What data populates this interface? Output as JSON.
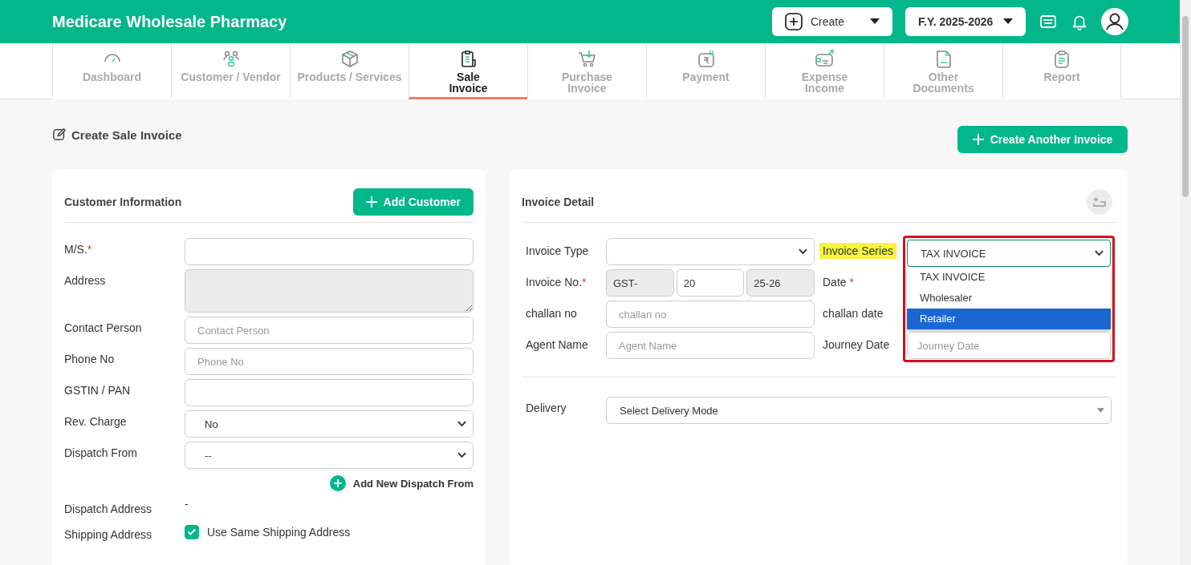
{
  "app": {
    "title": "Medicare Wholesale Pharmacy"
  },
  "header": {
    "create": "Create",
    "fiscal_year": "F.Y. 2025-2026"
  },
  "nav": [
    {
      "label": "Dashboard",
      "selected": false
    },
    {
      "label": "Customer / Vendor",
      "selected": false
    },
    {
      "label": "Products / Services",
      "selected": false
    },
    {
      "label": "Sale\nInvoice",
      "selected": true
    },
    {
      "label": "Purchase\nInvoice",
      "selected": false
    },
    {
      "label": "Payment",
      "selected": false
    },
    {
      "label": "Expense\nIncome",
      "selected": false
    },
    {
      "label": "Other\nDocuments",
      "selected": false
    },
    {
      "label": "Report",
      "selected": false
    }
  ],
  "page_heading": "Create Sale Invoice",
  "create_another_button": "Create Another Invoice",
  "customer_card": {
    "title": "Customer Information",
    "add_button": "Add Customer",
    "fields": [
      {
        "kind": "input",
        "label": "M/S.",
        "required_mark": "*"
      },
      {
        "kind": "textarea",
        "label": "Address",
        "disabled": true
      },
      {
        "kind": "input",
        "label": "Contact Person",
        "placeholder": "Contact Person"
      },
      {
        "kind": "input",
        "label": "Phone No",
        "placeholder": "Phone No"
      },
      {
        "kind": "input",
        "label": "GSTIN / PAN"
      },
      {
        "kind": "select",
        "label": "Rev. Charge",
        "value": "No"
      },
      {
        "kind": "select",
        "label": "Dispatch From",
        "value": "--"
      }
    ],
    "add_dispatch_link": "Add New Dispatch From",
    "dispatch_address": {
      "label": "Dispatch Address",
      "value": "-"
    },
    "shipping": {
      "label": "Shipping Address",
      "checkbox_label": "Use Same Shipping Address",
      "checked": true
    }
  },
  "invoice_card": {
    "title": "Invoice Detail",
    "left_fields": [
      {
        "kind": "select",
        "label": "Invoice Type"
      },
      {
        "kind": "parts",
        "label": "Invoice No.",
        "required_mark": "*",
        "parts": [
          {
            "value": "GST-",
            "disabled": true
          },
          {
            "value": "20",
            "disabled": false
          },
          {
            "value": "25-26",
            "disabled": true
          }
        ]
      },
      {
        "kind": "input",
        "label": "challan no",
        "placeholder": "challan no"
      },
      {
        "kind": "input",
        "label": "Agent Name",
        "placeholder": "Agent Name"
      }
    ],
    "right_labels": [
      {
        "label": "Invoice Series",
        "highlighted": true
      },
      {
        "label": "Date",
        "highlighted": false,
        "required_mark": "*"
      },
      {
        "label": "challan date",
        "highlighted": false
      },
      {
        "label": "Journey Date",
        "highlighted": false
      }
    ],
    "series": {
      "value": "TAX INVOICE",
      "open": true,
      "options": [
        {
          "label": "TAX INVOICE",
          "highlighted": false
        },
        {
          "label": "Wholesaler",
          "highlighted": false
        },
        {
          "label": "Retailer",
          "highlighted": true
        }
      ]
    },
    "journey_date": {
      "placeholder": "Journey Date"
    },
    "delivery": {
      "label": "Delivery",
      "value": "Select Delivery Mode"
    }
  }
}
